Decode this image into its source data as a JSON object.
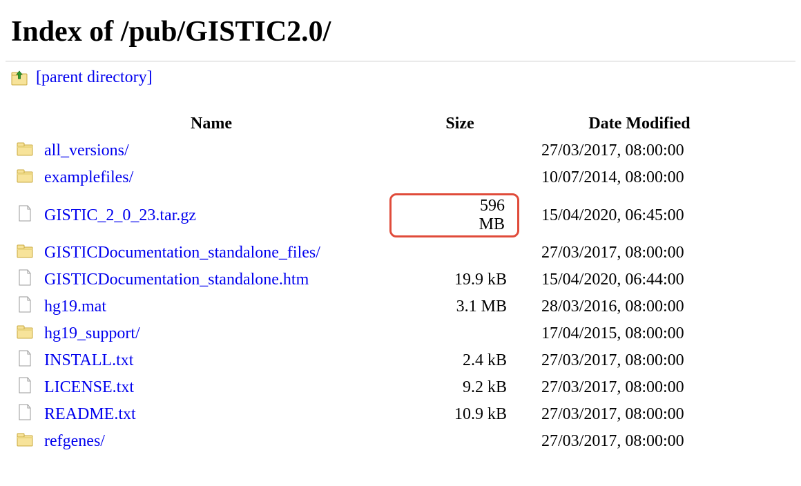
{
  "page": {
    "title": "Index of /pub/GISTIC2.0/",
    "parent_label": "[parent directory]"
  },
  "columns": {
    "name": "Name",
    "size": "Size",
    "date": "Date Modified"
  },
  "items": [
    {
      "type": "folder",
      "name": "all_versions/",
      "size": "",
      "date": "27/03/2017, 08:00:00",
      "highlight": false
    },
    {
      "type": "folder",
      "name": "examplefiles/",
      "size": "",
      "date": "10/07/2014, 08:00:00",
      "highlight": false
    },
    {
      "type": "file",
      "name": "GISTIC_2_0_23.tar.gz",
      "size": "596 MB",
      "date": "15/04/2020, 06:45:00",
      "highlight": true
    },
    {
      "type": "folder",
      "name": "GISTICDocumentation_standalone_files/",
      "size": "",
      "date": "27/03/2017, 08:00:00",
      "highlight": false
    },
    {
      "type": "file",
      "name": "GISTICDocumentation_standalone.htm",
      "size": "19.9 kB",
      "date": "15/04/2020, 06:44:00",
      "highlight": false
    },
    {
      "type": "file",
      "name": "hg19.mat",
      "size": "3.1 MB",
      "date": "28/03/2016, 08:00:00",
      "highlight": false
    },
    {
      "type": "folder",
      "name": "hg19_support/",
      "size": "",
      "date": "17/04/2015, 08:00:00",
      "highlight": false
    },
    {
      "type": "file",
      "name": "INSTALL.txt",
      "size": "2.4 kB",
      "date": "27/03/2017, 08:00:00",
      "highlight": false
    },
    {
      "type": "file",
      "name": "LICENSE.txt",
      "size": "9.2 kB",
      "date": "27/03/2017, 08:00:00",
      "highlight": false
    },
    {
      "type": "file",
      "name": "README.txt",
      "size": "10.9 kB",
      "date": "27/03/2017, 08:00:00",
      "highlight": false
    },
    {
      "type": "folder",
      "name": "refgenes/",
      "size": "",
      "date": "27/03/2017, 08:00:00",
      "highlight": false
    }
  ]
}
